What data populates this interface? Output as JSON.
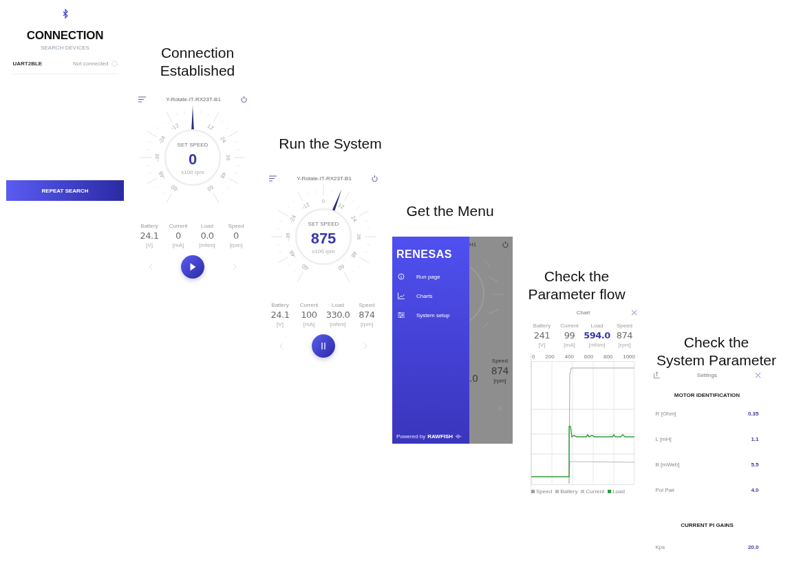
{
  "connection_screen": {
    "title": "CONNECTION",
    "subtitle": "SEARCH DEVICES",
    "devices": [
      {
        "name": "UART2BLE",
        "status": "Not connected"
      }
    ],
    "button": "REPEAT SEARCH"
  },
  "steps": [
    {
      "caption": "Connection\nEstablished",
      "screen": {
        "kind": "run",
        "title": "Y-Rotate-IT-RX23T-B1",
        "gauge": {
          "label": "SET SPEED",
          "value": "0",
          "unit": "x100 rpm",
          "level": 0.5,
          "ticks": [
            "-60",
            "-48",
            "-36",
            "-24",
            "-12",
            "12",
            "24",
            "36",
            "48",
            "60"
          ]
        },
        "stats": [
          {
            "label": "Battery",
            "value": "24.1",
            "unit": "[V]"
          },
          {
            "label": "Current",
            "value": "0",
            "unit": "[mA]"
          },
          {
            "label": "Load",
            "value": "0.0",
            "unit": "[mNm]"
          },
          {
            "label": "Speed",
            "value": "0",
            "unit": "[rpm]"
          }
        ],
        "running": false
      }
    },
    {
      "caption": "Run the System",
      "screen": {
        "kind": "run",
        "title": "Y-Rotate-IT-RX23T-B1",
        "gauge": {
          "label": "SET SPEED",
          "value": "875",
          "unit": "x100 rpm",
          "level": 0.57,
          "ticks": [
            "-60",
            "-48",
            "-36",
            "-24",
            "-12",
            "0",
            "12",
            "24",
            "36",
            "48",
            "60"
          ]
        },
        "stats": [
          {
            "label": "Battery",
            "value": "24.1",
            "unit": "[V]"
          },
          {
            "label": "Current",
            "value": "100",
            "unit": "[mA]"
          },
          {
            "label": "Load",
            "value": "330.0",
            "unit": "[mNm]"
          },
          {
            "label": "Speed",
            "value": "874",
            "unit": "[rpm]"
          }
        ],
        "running": true
      }
    },
    {
      "caption": "Get the Menu",
      "screen": {
        "kind": "menu",
        "logo": "RENESAS",
        "items": [
          {
            "kind": "info",
            "label": "Run page"
          },
          {
            "kind": "chart",
            "label": "Charts"
          },
          {
            "kind": "setup",
            "label": "System setup"
          }
        ],
        "footer": {
          "prefix": "Powered by",
          "brand": "RAWFISH"
        },
        "background": {
          "title": "H1",
          "label": "Speed",
          "values": [
            ".0",
            "874"
          ],
          "unit": "[rpm]"
        }
      }
    },
    {
      "caption": "Check the\nParameter flow",
      "screen": {
        "kind": "chart",
        "title": "Chart",
        "stats": [
          {
            "label": "Battery",
            "value": "241",
            "unit": "[V]",
            "selected": false
          },
          {
            "label": "Current",
            "value": "99",
            "unit": "[mA]",
            "selected": false
          },
          {
            "label": "Load",
            "value": "594.0",
            "unit": "[mNm]",
            "selected": true
          },
          {
            "label": "Speed",
            "value": "874",
            "unit": "[rpm]",
            "selected": false
          }
        ],
        "x_tick_labels": [
          "0",
          "200",
          "400",
          "600",
          "800",
          "1000"
        ],
        "legend": [
          {
            "name": "Speed",
            "color": "#9e9e9e"
          },
          {
            "name": "Battery",
            "color": "#bdbdbd"
          },
          {
            "name": "Current",
            "color": "#c8c8c8"
          },
          {
            "name": "Load",
            "color": "#2e9e3a"
          }
        ]
      }
    },
    {
      "caption": "Check the\nSystem Parameter",
      "screen": {
        "kind": "settings",
        "title": "Settings",
        "sections": [
          {
            "title": "MOTOR IDENTIFICATION",
            "rows": [
              {
                "label": "R [Ohm]",
                "value": "0.35"
              },
              {
                "label": "L [mH]",
                "value": "1.1"
              },
              {
                "label": "B [mWeb]",
                "value": "5.5"
              },
              {
                "label": "Pol Pair",
                "value": "4.0"
              }
            ]
          },
          {
            "title": "CURRENT PI GAINS",
            "rows": [
              {
                "label": "Kps",
                "value": "20.0"
              }
            ]
          }
        ]
      }
    }
  ]
}
